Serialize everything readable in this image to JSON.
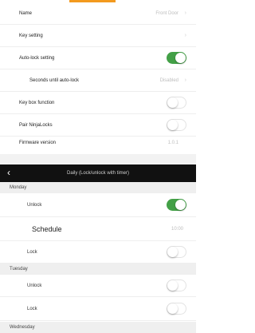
{
  "theme": {
    "accent": "#f39a1e",
    "toggle_on": "#43a047"
  },
  "settings": {
    "name": {
      "label": "Name",
      "value": "Front Door"
    },
    "key_setting": {
      "label": "Key setting"
    },
    "auto_lock": {
      "label": "Auto-lock setting",
      "on": true
    },
    "seconds": {
      "label": "Seconds until auto-lock",
      "value": "Disabled"
    },
    "key_box": {
      "label": "Key box function",
      "on": false
    },
    "pair": {
      "label": "Pair NinjaLocks",
      "on": false
    },
    "firmware": {
      "label": "Firmware version",
      "value": "1.0.1"
    }
  },
  "daily": {
    "back_glyph": "‹",
    "title": "Daily (Lock/unlock with timer)",
    "monday": {
      "label": "Monday",
      "unlock": {
        "label": "Unlock",
        "on": true
      },
      "schedule": {
        "label": "Schedule",
        "value": "10:00"
      },
      "lock": {
        "label": "Lock",
        "on": false
      }
    },
    "tuesday": {
      "label": "Tuesday",
      "unlock": {
        "label": "Unlock",
        "on": false
      },
      "lock": {
        "label": "Lock",
        "on": false
      }
    },
    "wednesday": {
      "label": "Wednesday"
    }
  }
}
